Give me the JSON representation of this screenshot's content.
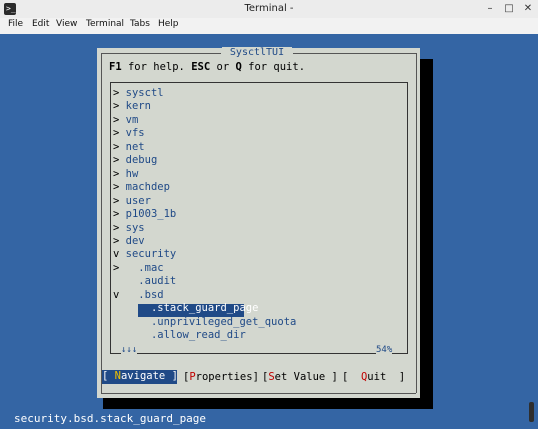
{
  "window": {
    "title": "Terminal -",
    "icon": "terminal-icon",
    "controls": [
      "minimize-icon",
      "maximize-icon",
      "close-icon"
    ]
  },
  "menubar": {
    "items": [
      "File",
      "Edit",
      "View",
      "Terminal",
      "Tabs",
      "Help"
    ]
  },
  "dialog": {
    "title": "SysctlTUI",
    "help": {
      "f1": "F1",
      "t1": " for help. ",
      "esc": "ESC",
      "t2": " or ",
      "q": "Q",
      "t3": " for quit."
    },
    "tree": [
      {
        "arrow": ">",
        "label": "sysctl"
      },
      {
        "arrow": ">",
        "label": "kern"
      },
      {
        "arrow": ">",
        "label": "vm"
      },
      {
        "arrow": ">",
        "label": "vfs"
      },
      {
        "arrow": ">",
        "label": "net"
      },
      {
        "arrow": ">",
        "label": "debug"
      },
      {
        "arrow": ">",
        "label": "hw"
      },
      {
        "arrow": ">",
        "label": "machdep"
      },
      {
        "arrow": ">",
        "label": "user"
      },
      {
        "arrow": ">",
        "label": "p1003_1b"
      },
      {
        "arrow": ">",
        "label": "sys"
      },
      {
        "arrow": ">",
        "label": "dev"
      },
      {
        "arrow": "v",
        "label": "security"
      },
      {
        "arrow": ">",
        "label": "  .mac"
      },
      {
        "arrow": " ",
        "label": "  .audit"
      },
      {
        "arrow": "v",
        "label": "  .bsd"
      },
      {
        "arrow": " ",
        "label": "    .stack_guard_page"
      },
      {
        "arrow": " ",
        "label": "    .unprivileged_get_quota"
      },
      {
        "arrow": " ",
        "label": "    .allow_read_dir"
      }
    ],
    "selected": ".stack_guard_page",
    "scroll_indicator": "↓↓↓",
    "scroll_percent": "54%",
    "buttons": {
      "navigate": {
        "open": "[ ",
        "hot": "N",
        "rest": "avigate",
        "close": " ]"
      },
      "properties": {
        "open": "[",
        "hot": "P",
        "rest": "roperties",
        "close": "]"
      },
      "set_value": {
        "open": "[",
        "hot": "S",
        "rest": "et Value",
        "close": " ]"
      },
      "quit": {
        "open": "[  ",
        "hot": "Q",
        "rest": "uit",
        "close": "  ]"
      }
    }
  },
  "status": {
    "path": "security.bsd.stack_guard_page"
  },
  "colors": {
    "terminal_bg": "#3465a4",
    "dialog_bg": "#d3d7cf",
    "accent": "#204a87",
    "hotkey": "#c00000"
  }
}
